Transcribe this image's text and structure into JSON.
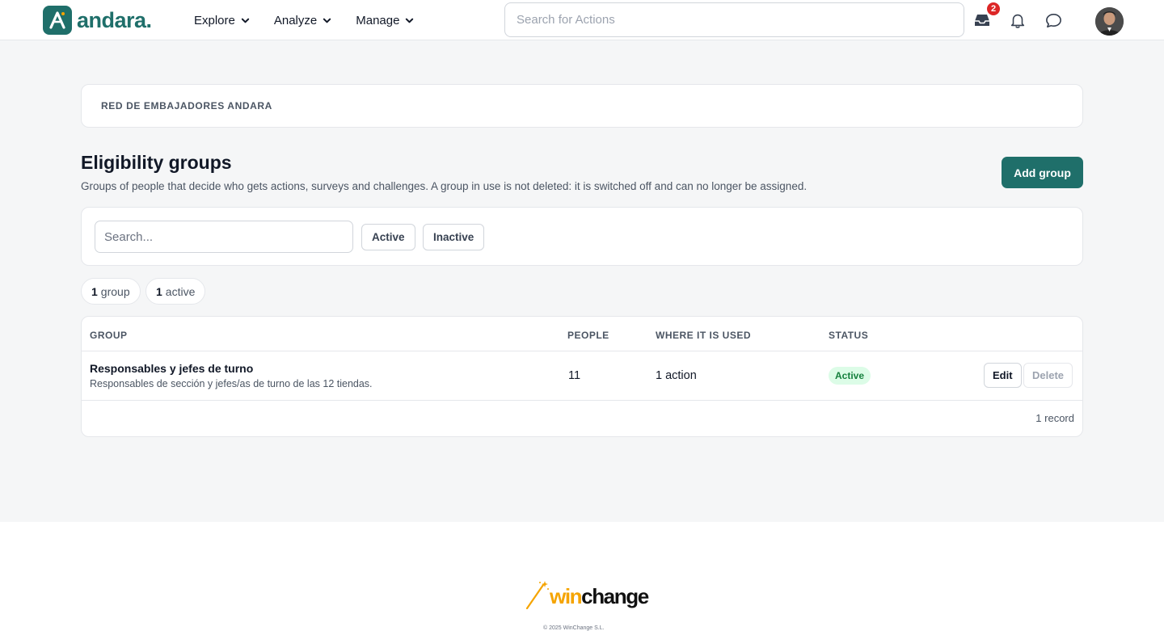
{
  "header": {
    "brand": "andara.",
    "nav": [
      {
        "label": "Explore"
      },
      {
        "label": "Analyze"
      },
      {
        "label": "Manage"
      }
    ],
    "search_placeholder": "Search for Actions",
    "inbox_badge": "2"
  },
  "breadcrumb": "RED DE EMBAJADORES ANDARA",
  "page": {
    "title": "Eligibility groups",
    "description": "Groups of people that decide who gets actions, surveys and challenges. A group in use is not deleted: it is switched off and can no longer be assigned.",
    "add_button": "Add group"
  },
  "filters": {
    "search_placeholder": "Search...",
    "active_label": "Active",
    "inactive_label": "Inactive"
  },
  "stats": [
    {
      "count": "1",
      "label": "group"
    },
    {
      "count": "1",
      "label": "active"
    }
  ],
  "table": {
    "columns": [
      "GROUP",
      "PEOPLE",
      "WHERE IT IS USED",
      "STATUS"
    ],
    "rows": [
      {
        "name": "Responsables y jefes de turno",
        "description": "Responsables de sección y jefes/as de turno de las 12 tiendas.",
        "people": "11",
        "used_in": "1 action",
        "status": "Active",
        "edit_label": "Edit",
        "delete_label": "Delete"
      }
    ],
    "record_count": "1 record"
  },
  "footer": {
    "brand_win": "win",
    "brand_change": "change",
    "copyright": "© 2025 WinChange S.L."
  },
  "colors": {
    "brand_teal": "#1f6f6a",
    "status_active_bg": "#dcfce7",
    "status_active_text": "#15803d",
    "badge_red": "#dc2626",
    "winchange_orange": "#f5a400"
  }
}
